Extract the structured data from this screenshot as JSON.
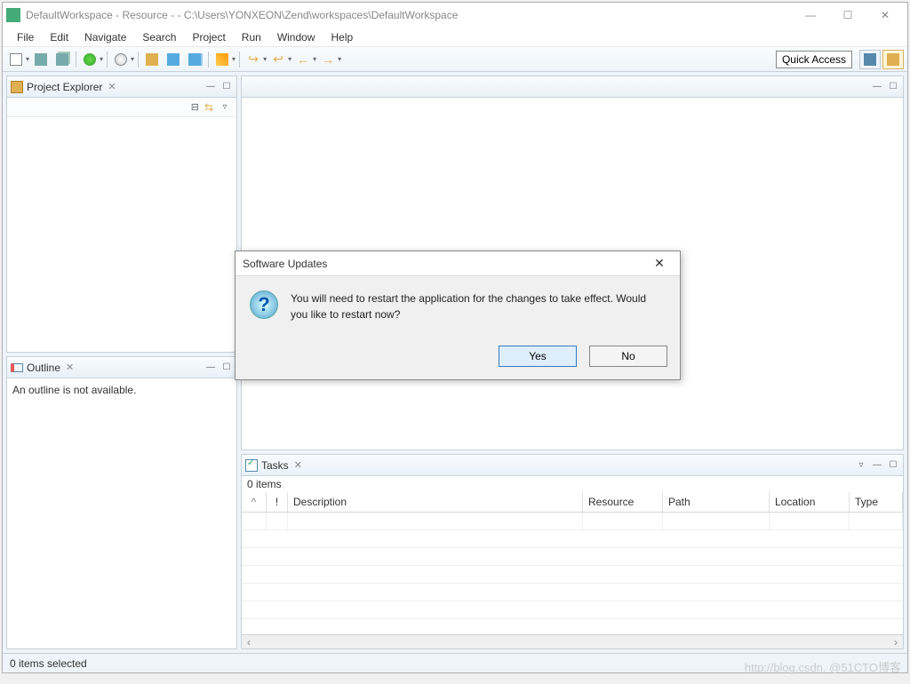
{
  "window": {
    "title": "DefaultWorkspace - Resource -  - C:\\Users\\YONXEON\\Zend\\workspaces\\DefaultWorkspace"
  },
  "menu": [
    "File",
    "Edit",
    "Navigate",
    "Search",
    "Project",
    "Run",
    "Window",
    "Help"
  ],
  "quick_access": "Quick Access",
  "views": {
    "project_explorer": {
      "title": "Project Explorer"
    },
    "outline": {
      "title": "Outline",
      "body": "An outline is not available."
    },
    "tasks": {
      "title": "Tasks",
      "count": "0 items",
      "columns": [
        "",
        "!",
        "Description",
        "Resource",
        "Path",
        "Location",
        "Type"
      ]
    }
  },
  "statusbar": "0 items selected",
  "dialog": {
    "title": "Software Updates",
    "message": "You will need to restart the application for the changes to take effect. Would you like to restart now?",
    "yes": "Yes",
    "no": "No"
  },
  "watermark": "http://blog.csdn.   @51CTO博客"
}
